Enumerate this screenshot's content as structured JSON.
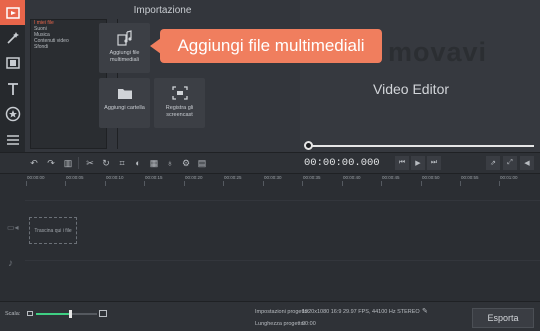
{
  "import_panel": {
    "title": "Importazione",
    "categories": [
      "I miei file",
      "Suoni",
      "Musica",
      "Contenuti video",
      "Sfondi"
    ],
    "buttons": {
      "add_media": "Aggiungi file multimediali",
      "add_folder": "Aggiungi cartella",
      "record_screencast": "Registra gli screencast"
    }
  },
  "tooltip": {
    "text": "Aggiungi file multimediali"
  },
  "preview": {
    "logo_text": "movavi",
    "product": "Video Editor"
  },
  "toolbar": {
    "timecode": "00:00:00.000"
  },
  "ruler": {
    "ticks": [
      "00:00:00",
      "00:00:05",
      "00:00:10",
      "00:00:15",
      "00:00:20",
      "00:00:25",
      "00:00:30",
      "00:00:35",
      "00:00:40",
      "00:00:45",
      "00:00:50",
      "00:00:55",
      "00:01:00"
    ]
  },
  "timeline": {
    "drop_hint": "Trascina qui i file"
  },
  "bottom": {
    "scale_label": "Scala:",
    "scale_level": 0.55,
    "project_settings_label": "Impostazioni progetto:",
    "project_settings_value": "1920x1080 16:9 29.97 FPS, 44100 Hz STEREO",
    "project_length_label": "Lunghezza progetto:",
    "project_length_value": "00:00",
    "export_label": "Esporta"
  },
  "colors": {
    "accent": "#e8654a",
    "tooltip": "#f07e5e",
    "scale_fill": "#3fcf83"
  }
}
